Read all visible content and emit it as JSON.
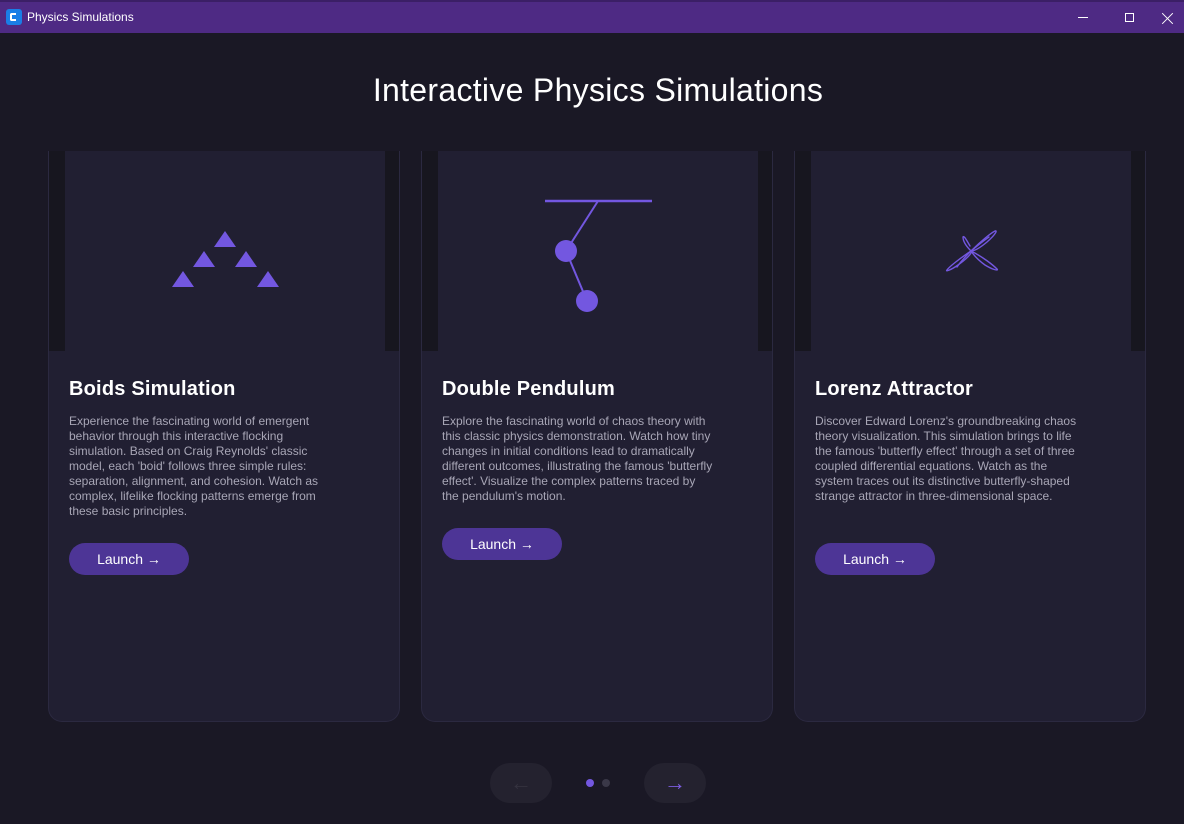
{
  "window": {
    "title": "Physics Simulations"
  },
  "page": {
    "title": "Interactive Physics Simulations"
  },
  "cards": [
    {
      "title": "Boids Simulation",
      "description": "Experience the fascinating world of emergent behavior through this interactive flocking simulation. Based on Craig Reynolds' classic model, each 'boid' follows three simple rules: separation, alignment, and cohesion. Watch as complex, lifelike flocking patterns emerge from these basic principles.",
      "button_label": "Launch →",
      "icon": "boids-triangles-icon"
    },
    {
      "title": "Double Pendulum",
      "description": "Explore the fascinating world of chaos theory with this classic physics demonstration. Watch how tiny changes in initial conditions lead to dramatically different outcomes, illustrating the famous 'butterfly effect'. Visualize the complex patterns traced by the pendulum's motion.",
      "button_label": "Launch →",
      "icon": "double-pendulum-icon"
    },
    {
      "title": "Lorenz Attractor",
      "description": "Discover Edward Lorenz's groundbreaking chaos theory visualization. This simulation brings to life the famous 'butterfly effect' through a set of three coupled differential equations. Watch as the system traces out its distinctive butterfly-shaped strange attractor in three-dimensional space.",
      "button_label": "Launch →",
      "icon": "lorenz-attractor-icon"
    }
  ],
  "pagination": {
    "prev_label": "←",
    "next_label": "→",
    "page_count": 2,
    "current_page": 1
  },
  "colors": {
    "accent": "#7357e0",
    "button": "#4d3596",
    "titlebar": "#4e2a84",
    "background": "#1a1825",
    "card": "#211f32"
  }
}
